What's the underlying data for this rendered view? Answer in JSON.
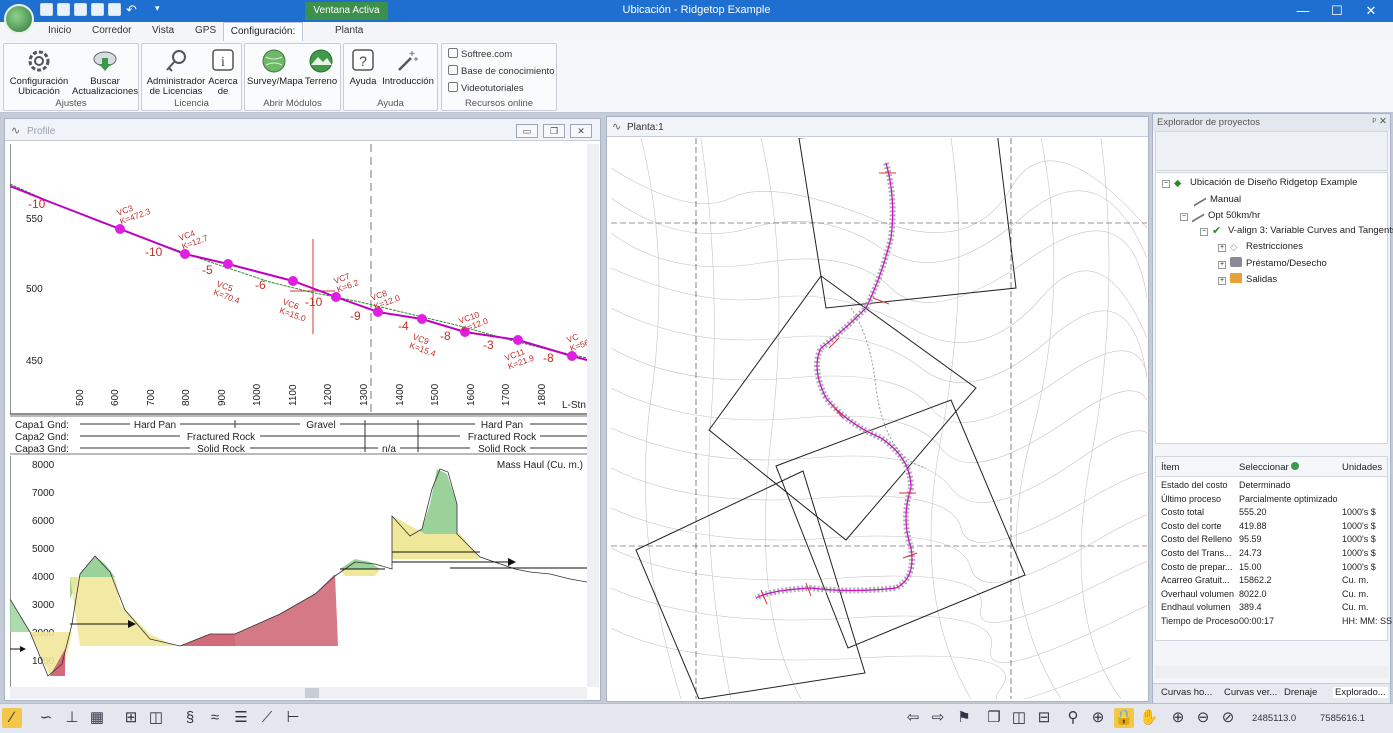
{
  "window": {
    "title": "Ubicación - Ridgetop Example",
    "context_tab": "Ventana Activa",
    "minimize": "—",
    "maximize": "☐",
    "close": "✕"
  },
  "tabs": [
    "Inicio",
    "Corredor",
    "Vista",
    "GPS",
    "Configuración:",
    "Planta"
  ],
  "ribbon": {
    "ajustes": {
      "label": "Ajustes",
      "btn1_l1": "Configuración",
      "btn1_l2": "Ubicación",
      "btn2_l1": "Buscar",
      "btn2_l2": "Actualizaciones"
    },
    "licencia": {
      "label": "Licencia",
      "btn1_l1": "Administrador",
      "btn1_l2": "de Licencias",
      "btn2_l1": "Acerca",
      "btn2_l2": "de"
    },
    "modulos": {
      "label": "Abrir Módulos",
      "btn1": "Survey/Mapa",
      "btn2": "Terreno"
    },
    "ayuda": {
      "label": "Ayuda",
      "btn1": "Ayuda",
      "btn2": "Introducción"
    },
    "recursos": {
      "label": "Recursos online",
      "link1": "Softree.com",
      "link2": "Base de conocimiento",
      "link3": "Videotutoriales"
    }
  },
  "profile": {
    "title": "Profile",
    "btn_min": "▭",
    "btn_restore": "❐",
    "btn_close": "✕",
    "elev_ticks": [
      "550",
      "500",
      "450"
    ],
    "station_ticks": [
      "500",
      "600",
      "700",
      "800",
      "900",
      "1000",
      "1100",
      "1200",
      "1300",
      "1400",
      "1500",
      "1600",
      "1700",
      "1800"
    ],
    "station_label": "L-Stn",
    "grades": [
      "-10",
      "-10",
      "-5",
      "-6",
      "-10",
      "-9",
      "-4",
      "-8",
      "-3",
      "-8"
    ],
    "curves": [
      {
        "name": "VC3",
        "k": "K=472.3"
      },
      {
        "name": "VC4",
        "k": "K=12.7"
      },
      {
        "name": "VC5",
        "k": "K=70.4"
      },
      {
        "name": "VC6",
        "k": "K=15.0"
      },
      {
        "name": "VC7",
        "k": "K=6.2"
      },
      {
        "name": "VC8",
        "k": "K=12.0"
      },
      {
        "name": "VC9",
        "k": "K=15.4"
      },
      {
        "name": "VC10",
        "k": "K=12.0"
      },
      {
        "name": "VC11",
        "k": "K=21.9"
      },
      {
        "name": "VC",
        "k": "K=56"
      }
    ],
    "layers": [
      {
        "name": "Capa1 Gnd:",
        "segments": [
          "Hard Pan",
          "Gravel",
          "Hard Pan"
        ]
      },
      {
        "name": "Capa2 Gnd:",
        "segments": [
          "Fractured Rock",
          "Fractured Rock"
        ]
      },
      {
        "name": "Capa3 Gnd:",
        "segments": [
          "Solid Rock",
          "n/a",
          "Solid Rock"
        ]
      }
    ],
    "mass_haul_title": "Mass Haul (Cu. m.)",
    "mass_ticks": [
      "8000",
      "7000",
      "6000",
      "5000",
      "4000",
      "3000",
      "2000",
      "1000"
    ]
  },
  "plan": {
    "title": "Planta:1"
  },
  "explorer": {
    "title": "Explorador de proyectos",
    "pin": "ᵖ",
    "close": "✕",
    "tree": {
      "root": "Ubicación de Diseño Ridgetop Example",
      "manual": "Manual",
      "opt": "Opt 50km/hr",
      "valign": "V-align 3: Variable Curves and Tangents",
      "restricciones": "Restricciones",
      "prestamo": "Préstamo/Desecho",
      "salidas": "Salidas"
    },
    "props_headers": [
      "Ítem",
      "Seleccionar",
      "Unidades"
    ],
    "props": [
      {
        "item": "Estado del costo",
        "value": "Determinado",
        "unit": ""
      },
      {
        "item": "Último proceso",
        "value": "Parcialmente optimizado",
        "unit": ""
      },
      {
        "item": "Costo total",
        "value": "555.20",
        "unit": "1000's $"
      },
      {
        "item": "Costo del corte",
        "value": "419.88",
        "unit": "1000's $"
      },
      {
        "item": "Costo del Relleno",
        "value": "95.59",
        "unit": "1000's $"
      },
      {
        "item": "Costo del Trans...",
        "value": "24.73",
        "unit": "1000's $"
      },
      {
        "item": "Costo de prepar...",
        "value": "15.00",
        "unit": "1000's $"
      },
      {
        "item": "Acarreo Gratuit...",
        "value": "15862.2",
        "unit": "Cu. m."
      },
      {
        "item": "Overhaul volumen",
        "value": "8022.0",
        "unit": "Cu. m."
      },
      {
        "item": "Endhaul volumen",
        "value": "389.4",
        "unit": "Cu. m."
      },
      {
        "item": "Tiempo de Proceso",
        "value": "00:00:17",
        "unit": "HH: MM: SS"
      }
    ],
    "tabs": [
      "Curvas ho...",
      "Curvas ver...",
      "Drenaje",
      "Explorado..."
    ]
  },
  "status": {
    "x": "2485113.0",
    "y": "7585616.1"
  },
  "colors": {
    "titlebar": "#1e6fd0",
    "context_tab": "#3c8f4c",
    "alignment": "#c000c0",
    "annotation": "#c0302a"
  }
}
